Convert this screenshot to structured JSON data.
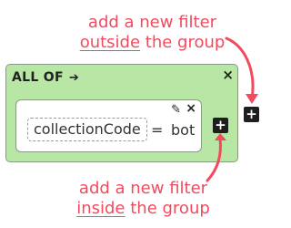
{
  "annotations": {
    "outside": {
      "line1": "add a new filter",
      "underlined": "outside",
      "rest": " the group"
    },
    "inside": {
      "line1": "add a new filter",
      "underlined": "inside",
      "rest": " the group"
    }
  },
  "group": {
    "title": "ALL OF",
    "close": "×",
    "arrow": "➔"
  },
  "filter": {
    "field": "collectionCode",
    "operator": "=",
    "value": "bot",
    "edit": "✎",
    "close": "×"
  },
  "buttons": {
    "add_inside": "+",
    "add_outside": "+"
  },
  "colors": {
    "annotation": "#f24a5e",
    "group_bg": "#b8e6a4",
    "button_bg": "#1e1e1e"
  }
}
